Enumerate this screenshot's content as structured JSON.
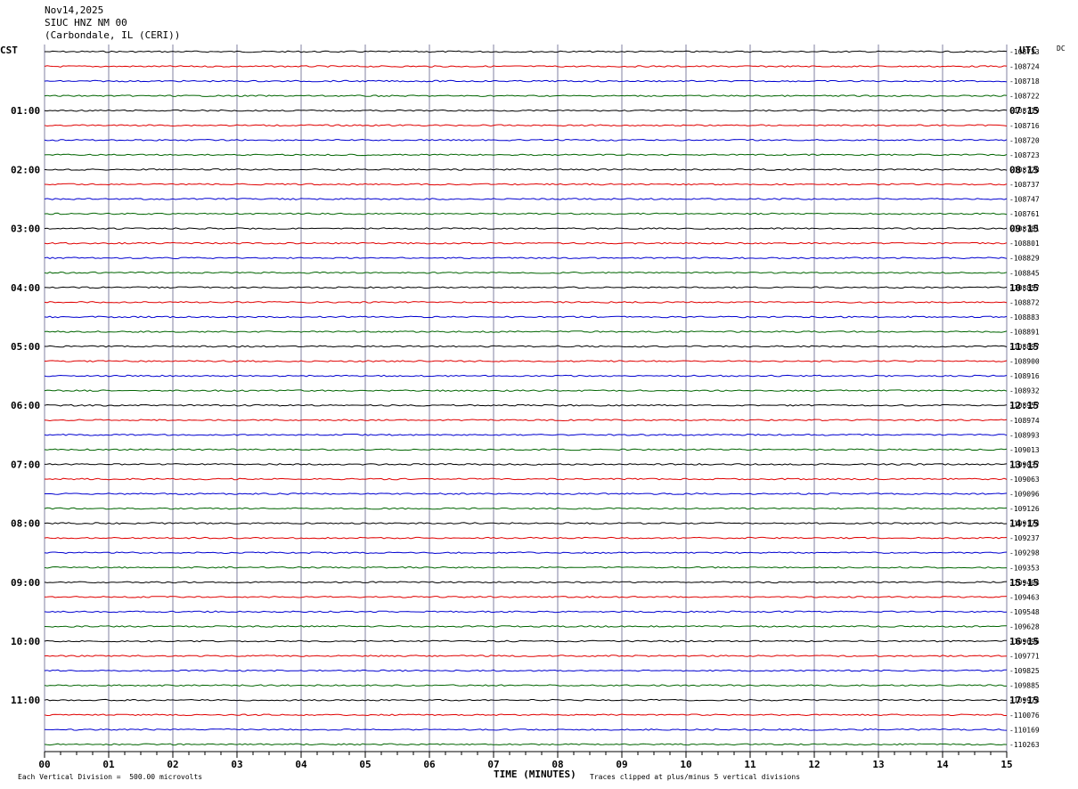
{
  "header": {
    "date": "Nov14,2025",
    "station": "SIUC HNZ NM 00",
    "location": "(Carbondale, IL (CERI))"
  },
  "left_zone": "CST",
  "right_zone": "UTC",
  "dc_label": "DC",
  "footer": {
    "scale": "Each Vertical Division =  500.00 microvolts",
    "xlabel": "TIME (MINUTES)",
    "clip": "Traces clipped at plus/minus 5 vertical divisions"
  },
  "colors": {
    "trace_cycle": [
      "#000000",
      "#e00000",
      "#0000d0",
      "#006400"
    ],
    "grid": "#8080a0"
  },
  "chart_data": {
    "type": "line",
    "title": "",
    "xlabel": "TIME (MINUTES)",
    "xlim": [
      0,
      15
    ],
    "x_ticks": [
      "00",
      "01",
      "02",
      "03",
      "04",
      "05",
      "06",
      "07",
      "08",
      "09",
      "10",
      "11",
      "12",
      "13",
      "14",
      "15"
    ],
    "left_time_labels": [
      "01:00",
      "02:00",
      "03:00",
      "04:00",
      "05:00",
      "06:00",
      "07:00",
      "08:00",
      "09:00",
      "10:00",
      "11:00"
    ],
    "right_time_labels": [
      "07:15",
      "08:15",
      "09:15",
      "10:15",
      "11:15",
      "12:15",
      "13:15",
      "14:15",
      "15:15",
      "16:15",
      "17:15"
    ],
    "dc_offsets": [
      "-108723",
      "-108724",
      "-108718",
      "-108722",
      "-108719",
      "-108716",
      "-108720",
      "-108723",
      "-108728",
      "-108737",
      "-108747",
      "-108761",
      "-108781",
      "-108801",
      "-108829",
      "-108845",
      "-108857",
      "-108872",
      "-108883",
      "-108891",
      "-108897",
      "-108900",
      "-108916",
      "-108932",
      "-108957",
      "-108974",
      "-108993",
      "-109013",
      "-109037",
      "-109063",
      "-109096",
      "-109126",
      "-109174",
      "-109237",
      "-109298",
      "-109353",
      "-109404",
      "-109463",
      "-109548",
      "-109628",
      "-109696",
      "-109771",
      "-109825",
      "-109885",
      "-109974",
      "-110076",
      "-110169",
      "-110263"
    ]
  }
}
